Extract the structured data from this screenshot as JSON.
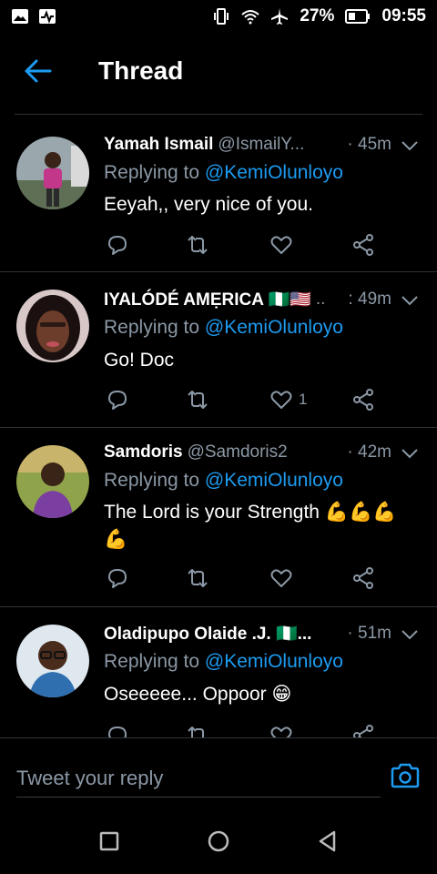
{
  "status_bar": {
    "battery": "27%",
    "time": "09:55",
    "icons": [
      "image-icon",
      "activity-icon",
      "vibrate-icon",
      "wifi-icon",
      "airplane-icon",
      "battery-icon"
    ]
  },
  "header": {
    "title": "Thread",
    "back_icon": "arrow-left-icon"
  },
  "tweets": [
    {
      "name": "Yamah Ismail",
      "handle": "@IsmailY...",
      "time": "· 45m",
      "replying_prefix": "Replying to",
      "mention": "@KemiOlunloyo",
      "text": "Eeyah,, very nice of you.",
      "like_count": ""
    },
    {
      "name": "IYALÓDÉ AMẸRICA 🇳🇬🇺🇸",
      "handle": "..",
      "time": ": 49m",
      "replying_prefix": "Replying to",
      "mention": "@KemiOlunloyo",
      "text": "Go! Doc",
      "like_count": "1"
    },
    {
      "name": "Samdoris",
      "handle": "@Samdoris2",
      "time": "· 42m",
      "replying_prefix": "Replying to",
      "mention": "@KemiOlunloyo",
      "text": "The Lord is your Strength 💪💪💪💪",
      "like_count": ""
    },
    {
      "name": "Oladipupo Olaide .J. 🇳🇬...",
      "handle": "",
      "time": "· 51m",
      "replying_prefix": "Replying to",
      "mention": "@KemiOlunloyo",
      "text": "Oseeeee... Oppoor 😁",
      "like_count": ""
    }
  ],
  "reply_bar": {
    "placeholder": "Tweet your reply"
  },
  "colors": {
    "accent": "#1d9bf0",
    "muted": "#8b98a5",
    "divider": "#2f3336",
    "background": "#000000"
  }
}
